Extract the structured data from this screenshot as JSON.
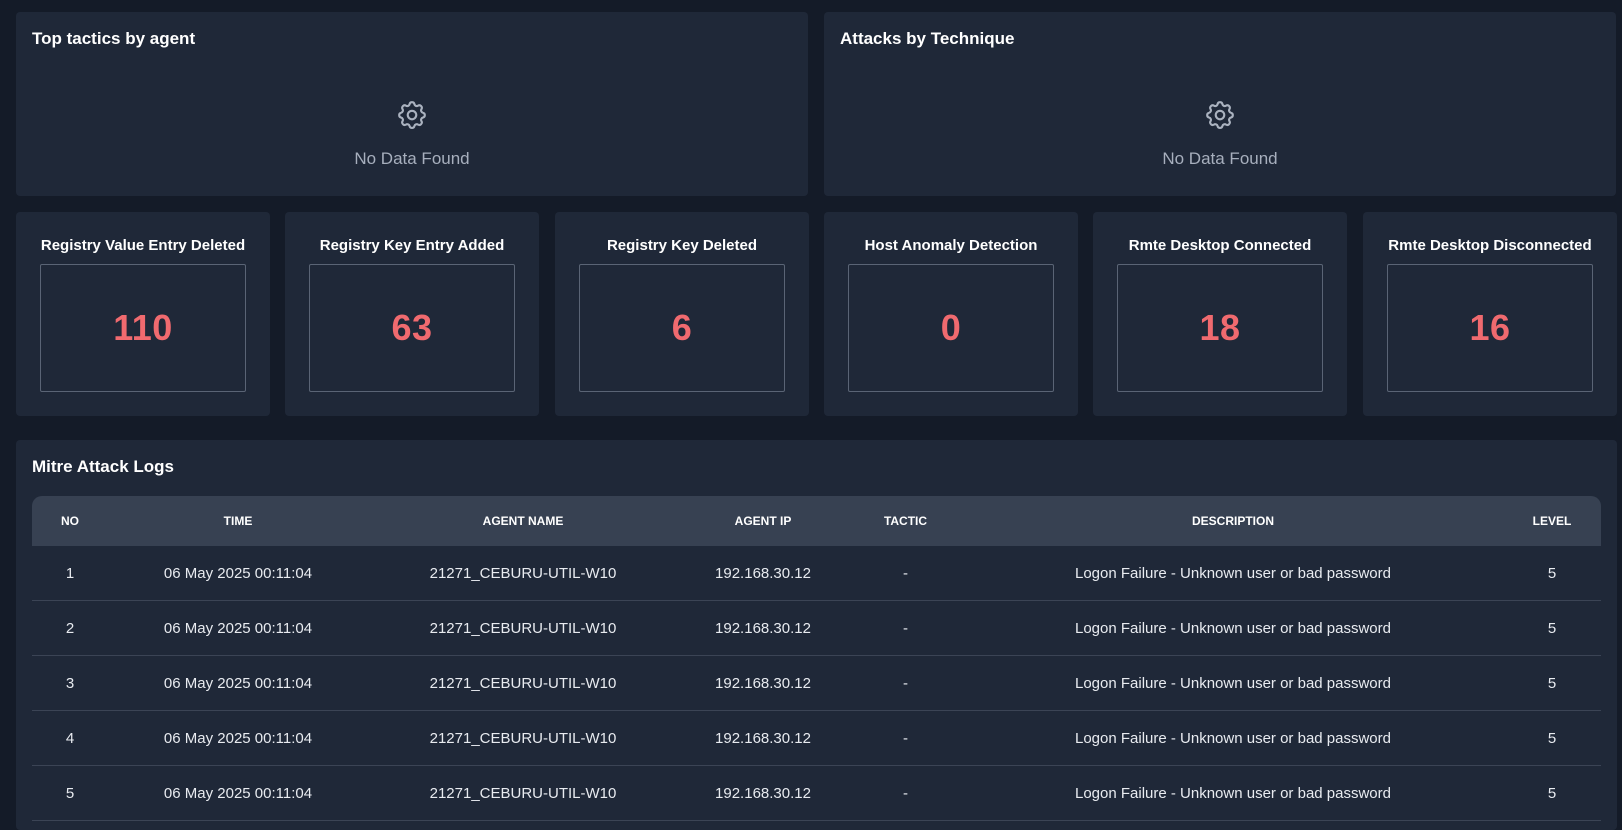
{
  "top_panels": [
    {
      "title": "Top tactics by agent",
      "empty_text": "No Data Found",
      "icon": "gear-icon"
    },
    {
      "title": "Attacks by Technique",
      "empty_text": "No Data Found",
      "icon": "gear-icon"
    }
  ],
  "stats": [
    {
      "title": "Registry Value Entry Deleted",
      "value": "110"
    },
    {
      "title": "Registry Key Entry Added",
      "value": "63"
    },
    {
      "title": "Registry Key Deleted",
      "value": "6"
    },
    {
      "title": "Host Anomaly Detection",
      "value": "0"
    },
    {
      "title": "Rmte Desktop Connected",
      "value": "18"
    },
    {
      "title": "Rmte Desktop Disconnected",
      "value": "16"
    }
  ],
  "colors": {
    "accent_value": "#f06a6f",
    "panel_bg": "#1f2838",
    "page_bg": "#141b28"
  },
  "logs": {
    "title": "Mitre Attack Logs",
    "columns": [
      "NO",
      "TIME",
      "AGENT NAME",
      "AGENT IP",
      "TACTIC",
      "DESCRIPTION",
      "LEVEL"
    ],
    "rows": [
      [
        "1",
        "06 May 2025 00:11:04",
        "21271_CEBURU-UTIL-W10",
        "192.168.30.12",
        "-",
        "Logon Failure - Unknown user or bad password",
        "5"
      ],
      [
        "2",
        "06 May 2025 00:11:04",
        "21271_CEBURU-UTIL-W10",
        "192.168.30.12",
        "-",
        "Logon Failure - Unknown user or bad password",
        "5"
      ],
      [
        "3",
        "06 May 2025 00:11:04",
        "21271_CEBURU-UTIL-W10",
        "192.168.30.12",
        "-",
        "Logon Failure - Unknown user or bad password",
        "5"
      ],
      [
        "4",
        "06 May 2025 00:11:04",
        "21271_CEBURU-UTIL-W10",
        "192.168.30.12",
        "-",
        "Logon Failure - Unknown user or bad password",
        "5"
      ],
      [
        "5",
        "06 May 2025 00:11:04",
        "21271_CEBURU-UTIL-W10",
        "192.168.30.12",
        "-",
        "Logon Failure - Unknown user or bad password",
        "5"
      ]
    ]
  }
}
